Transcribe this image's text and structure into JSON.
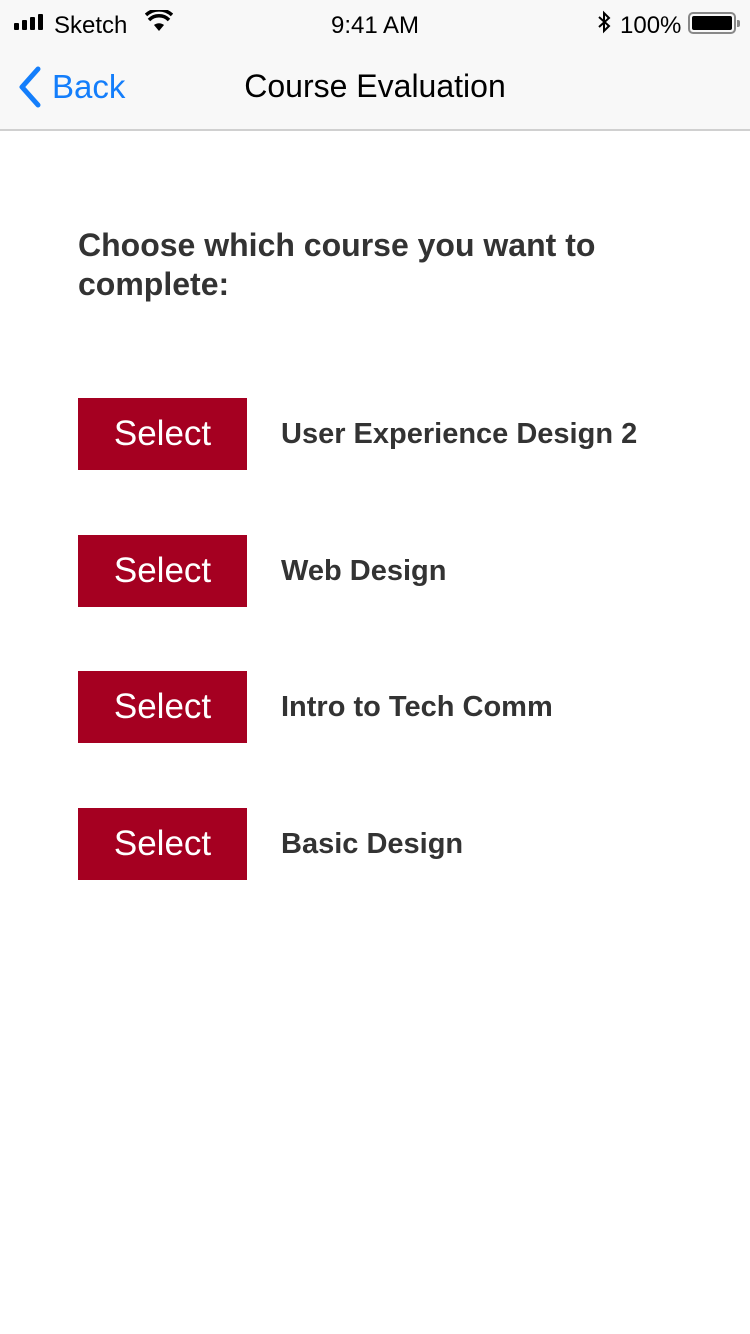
{
  "status": {
    "carrier": "Sketch",
    "time": "9:41 AM",
    "battery": "100%",
    "battery_level": 1.0
  },
  "nav": {
    "back_label": "Back",
    "title": "Course Evaluation"
  },
  "heading": "Choose which course you want to complete:",
  "colors": {
    "accent": "#A50021",
    "link": "#147EFB"
  },
  "courses": [
    {
      "button": "Select",
      "name": "User Experience Design 2"
    },
    {
      "button": "Select",
      "name": "Web Design"
    },
    {
      "button": "Select",
      "name": "Intro to Tech Comm"
    },
    {
      "button": "Select",
      "name": "Basic Design"
    }
  ]
}
